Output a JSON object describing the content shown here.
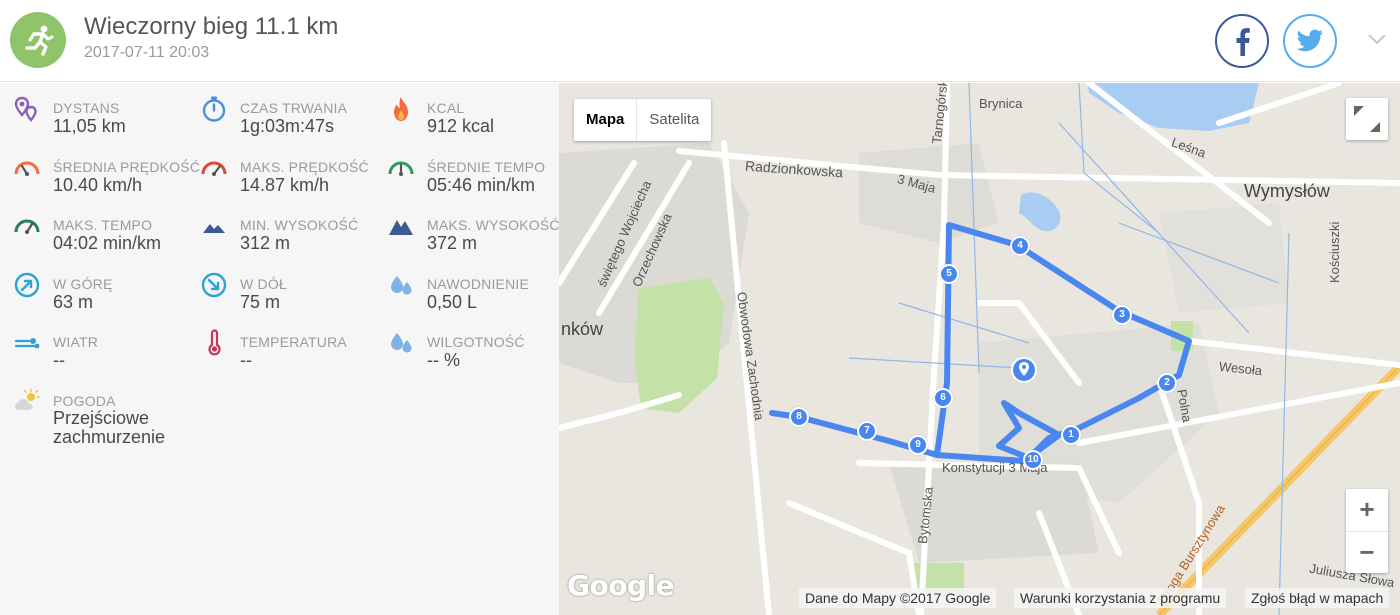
{
  "activity": {
    "title": "Wieczorny bieg 11.1 km",
    "date": "2017-07-11 20:03",
    "sport_icon": "running-icon",
    "accent": "#8fc46a"
  },
  "share": {
    "facebook_icon": "facebook-icon",
    "twitter_icon": "twitter-icon",
    "facebook_color": "#3b5998",
    "twitter_color": "#55acee"
  },
  "stats": [
    {
      "label": "DYSTANS",
      "value": "11,05 km",
      "icon": "distance-pin-icon"
    },
    {
      "label": "CZAS TRWANIA",
      "value": "1g:03m:47s",
      "icon": "stopwatch-icon"
    },
    {
      "label": "KCAL",
      "value": "912 kcal",
      "icon": "flame-icon"
    },
    {
      "label": "ŚREDNIA PRĘDKOŚĆ",
      "value": "10.40 km/h",
      "icon": "speedometer-icon"
    },
    {
      "label": "MAKS. PRĘDKOŚĆ",
      "value": "14.87 km/h",
      "icon": "speedometer-max-icon"
    },
    {
      "label": "ŚREDNIE TEMPO",
      "value": "05:46 min/km",
      "icon": "pace-gauge-icon"
    },
    {
      "label": "MAKS. TEMPO",
      "value": "04:02 min/km",
      "icon": "pace-max-icon"
    },
    {
      "label": "MIN. WYSOKOŚĆ",
      "value": "312 m",
      "icon": "mountain-min-icon"
    },
    {
      "label": "MAKS. WYSOKOŚĆ",
      "value": "372 m",
      "icon": "mountain-max-icon"
    },
    {
      "label": "W GÓRĘ",
      "value": "63 m",
      "icon": "arrow-up-right-icon"
    },
    {
      "label": "W DÓŁ",
      "value": "75 m",
      "icon": "arrow-down-right-icon"
    },
    {
      "label": "NAWODNIENIE",
      "value": "0,50 L",
      "icon": "water-drops-icon"
    },
    {
      "label": "WIATR",
      "value": "--",
      "icon": "wind-icon"
    },
    {
      "label": "TEMPERATURA",
      "value": "--",
      "icon": "thermometer-icon"
    },
    {
      "label": "WILGOTNOŚĆ",
      "value": "-- %",
      "icon": "humidity-icon"
    },
    {
      "label": "POGODA",
      "value": "Przejściowe zachmurzenie",
      "icon": "weather-partly-cloudy-icon"
    }
  ],
  "map": {
    "type_options": [
      "Mapa",
      "Satelita"
    ],
    "active_type": "Mapa",
    "zoom_in": "+",
    "zoom_out": "−",
    "google_logo": "Google",
    "attribution": "Dane do Mapy ©2017 Google",
    "terms": "Warunki korzystania z programu",
    "report": "Zgłoś błąd w mapach",
    "route_color": "#4a86f0",
    "labels": {
      "radzionkowska": "Radzionkowska",
      "tarnogorska": "Tarnogórska",
      "brynica": "Brynica",
      "trzeciego_maja": "3 Maja",
      "lesna": "Leśna",
      "wymyslow": "Wymysłów",
      "kosciuszki": "Kościuszki",
      "wojciecha": "świętego Wojciecha",
      "orzechowska": "Orzechowska",
      "obwodowa": "Obwodowa Zachodnia",
      "wesola": "Wesoła",
      "polna": "Polna",
      "konstytucji": "Konstytucji 3 Maja",
      "bytomska": "Bytomska",
      "bursztynowa": "Droga Bursztynowa",
      "juliusza": "Juliusza Słowa",
      "town_fragment": "nków"
    },
    "km_markers": [
      "1",
      "2",
      "3",
      "4",
      "5",
      "6",
      "7",
      "8",
      "9",
      "10"
    ]
  }
}
